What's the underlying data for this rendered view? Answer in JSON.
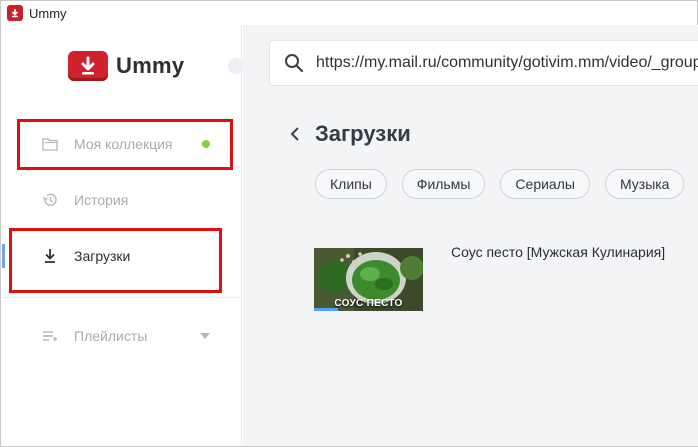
{
  "window": {
    "title": "Ummy"
  },
  "sidebar": {
    "logo_text": "Ummy",
    "items": [
      {
        "label": "Моя коллекция",
        "icon": "folder-icon",
        "status_dot_color": "#7ed23a"
      },
      {
        "label": "История",
        "icon": "history-icon"
      },
      {
        "label": "Загрузки",
        "icon": "download-icon",
        "active": true
      },
      {
        "label": "Плейлисты",
        "icon": "playlist-icon"
      }
    ]
  },
  "search": {
    "value": "https://my.mail.ru/community/gotivim.mm/video/_groupvideo/",
    "icon": "search-icon"
  },
  "main": {
    "title": "Загрузки",
    "filters": [
      "Клипы",
      "Фильмы",
      "Сериалы",
      "Музыка"
    ],
    "videos": [
      {
        "title": "Соус песто [Мужская Кулинария]",
        "thumb_caption": "СОУС ПЕСТО",
        "progress_fraction": 0.22
      }
    ]
  },
  "colors": {
    "accent": "#6aa7e8",
    "brand": "#d1212e",
    "highlight": "#e01010"
  }
}
